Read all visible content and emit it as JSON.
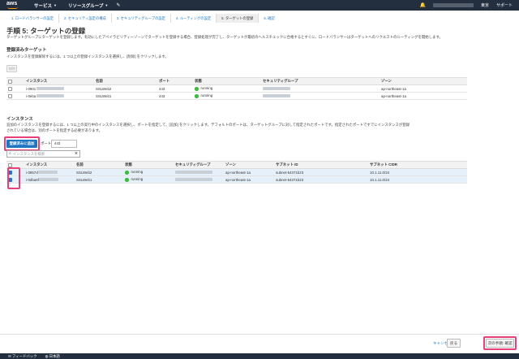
{
  "topbar": {
    "logo": "aws",
    "services": "サービス",
    "resource_groups": "リソースグループ",
    "region": "東京",
    "support": "サポート"
  },
  "steps": [
    "1. ロードバランサーの設定",
    "2. セキュリティ設定の構成",
    "3. セキュリティグループの設定",
    "4. ルーティングの設定",
    "5. ターゲットの登録",
    "6. 確認"
  ],
  "page": {
    "title": "手順 5: ターゲットの登録",
    "description": "ターゲットグループにターゲットを登録します。有効にしたアベイラビリティーゾーンでターゲットを登録する場合、登録処理が完了し、ターゲットが最初のヘルスチェックに合格するとすぐに、ロードバランサーはターゲットへのリクエストのルーティングを開始します。"
  },
  "registered": {
    "heading": "登録済みターゲット",
    "description": "インスタンスを登録解除するには、1 つ以上の登録インスタンスを選択し、[削除] をクリックします。",
    "remove_label": "削除",
    "columns": [
      "インスタンス",
      "名前",
      "ポート",
      "状態",
      "セキュリティグループ",
      "ゾーン"
    ],
    "rows": [
      {
        "instance": "i-0901",
        "name": "SSLWeb2",
        "port": "443",
        "state": "running",
        "zone": "ap-northeast-1a"
      },
      {
        "instance": "i-0eba",
        "name": "SSLWeb1",
        "port": "443",
        "state": "running",
        "zone": "ap-northeast-1a"
      }
    ]
  },
  "instances": {
    "heading": "インスタンス",
    "description_1": "追加のインスタンスを登録するには、1 つ以上の実行中のインスタンスを選択し、ポートを指定して、[追加] をクリックします。デフォルトのポートは、ターゲットグループに対して指定されたポートです。指定されたポートですでにインスタンスが登録",
    "description_2": "されている場合は、別のポートを指定する必要があります。",
    "add_button": "登録済みに追加",
    "port_label": "ポート",
    "port_value": "443",
    "search_placeholder": "インスタンスを検索",
    "columns": [
      "インスタンス",
      "名前",
      "状態",
      "セキュリティグループ",
      "ゾーン",
      "サブネット ID",
      "サブネット CIDR"
    ],
    "rows": [
      {
        "instance": "i-0857d",
        "name": "SSLWeb2",
        "state": "running",
        "zone": "ap-northeast-1a",
        "subnet": "subnet-54371b23",
        "cidr": "10.1.11.0/24"
      },
      {
        "instance": "i-0dba6f",
        "name": "SSLWeb1",
        "state": "running",
        "zone": "ap-northeast-1a",
        "subnet": "subnet-54371b23",
        "cidr": "10.1.11.0/24"
      }
    ]
  },
  "footer": {
    "cancel": "キャンセル",
    "back": "戻る",
    "next": "次の手順: 確認",
    "feedback": "フィードバック",
    "language": "日本語"
  },
  "colors": {
    "topbar": "#232f3e",
    "primary": "#1e76c2",
    "highlight": "#e8407a",
    "running": "#3fb93f"
  }
}
